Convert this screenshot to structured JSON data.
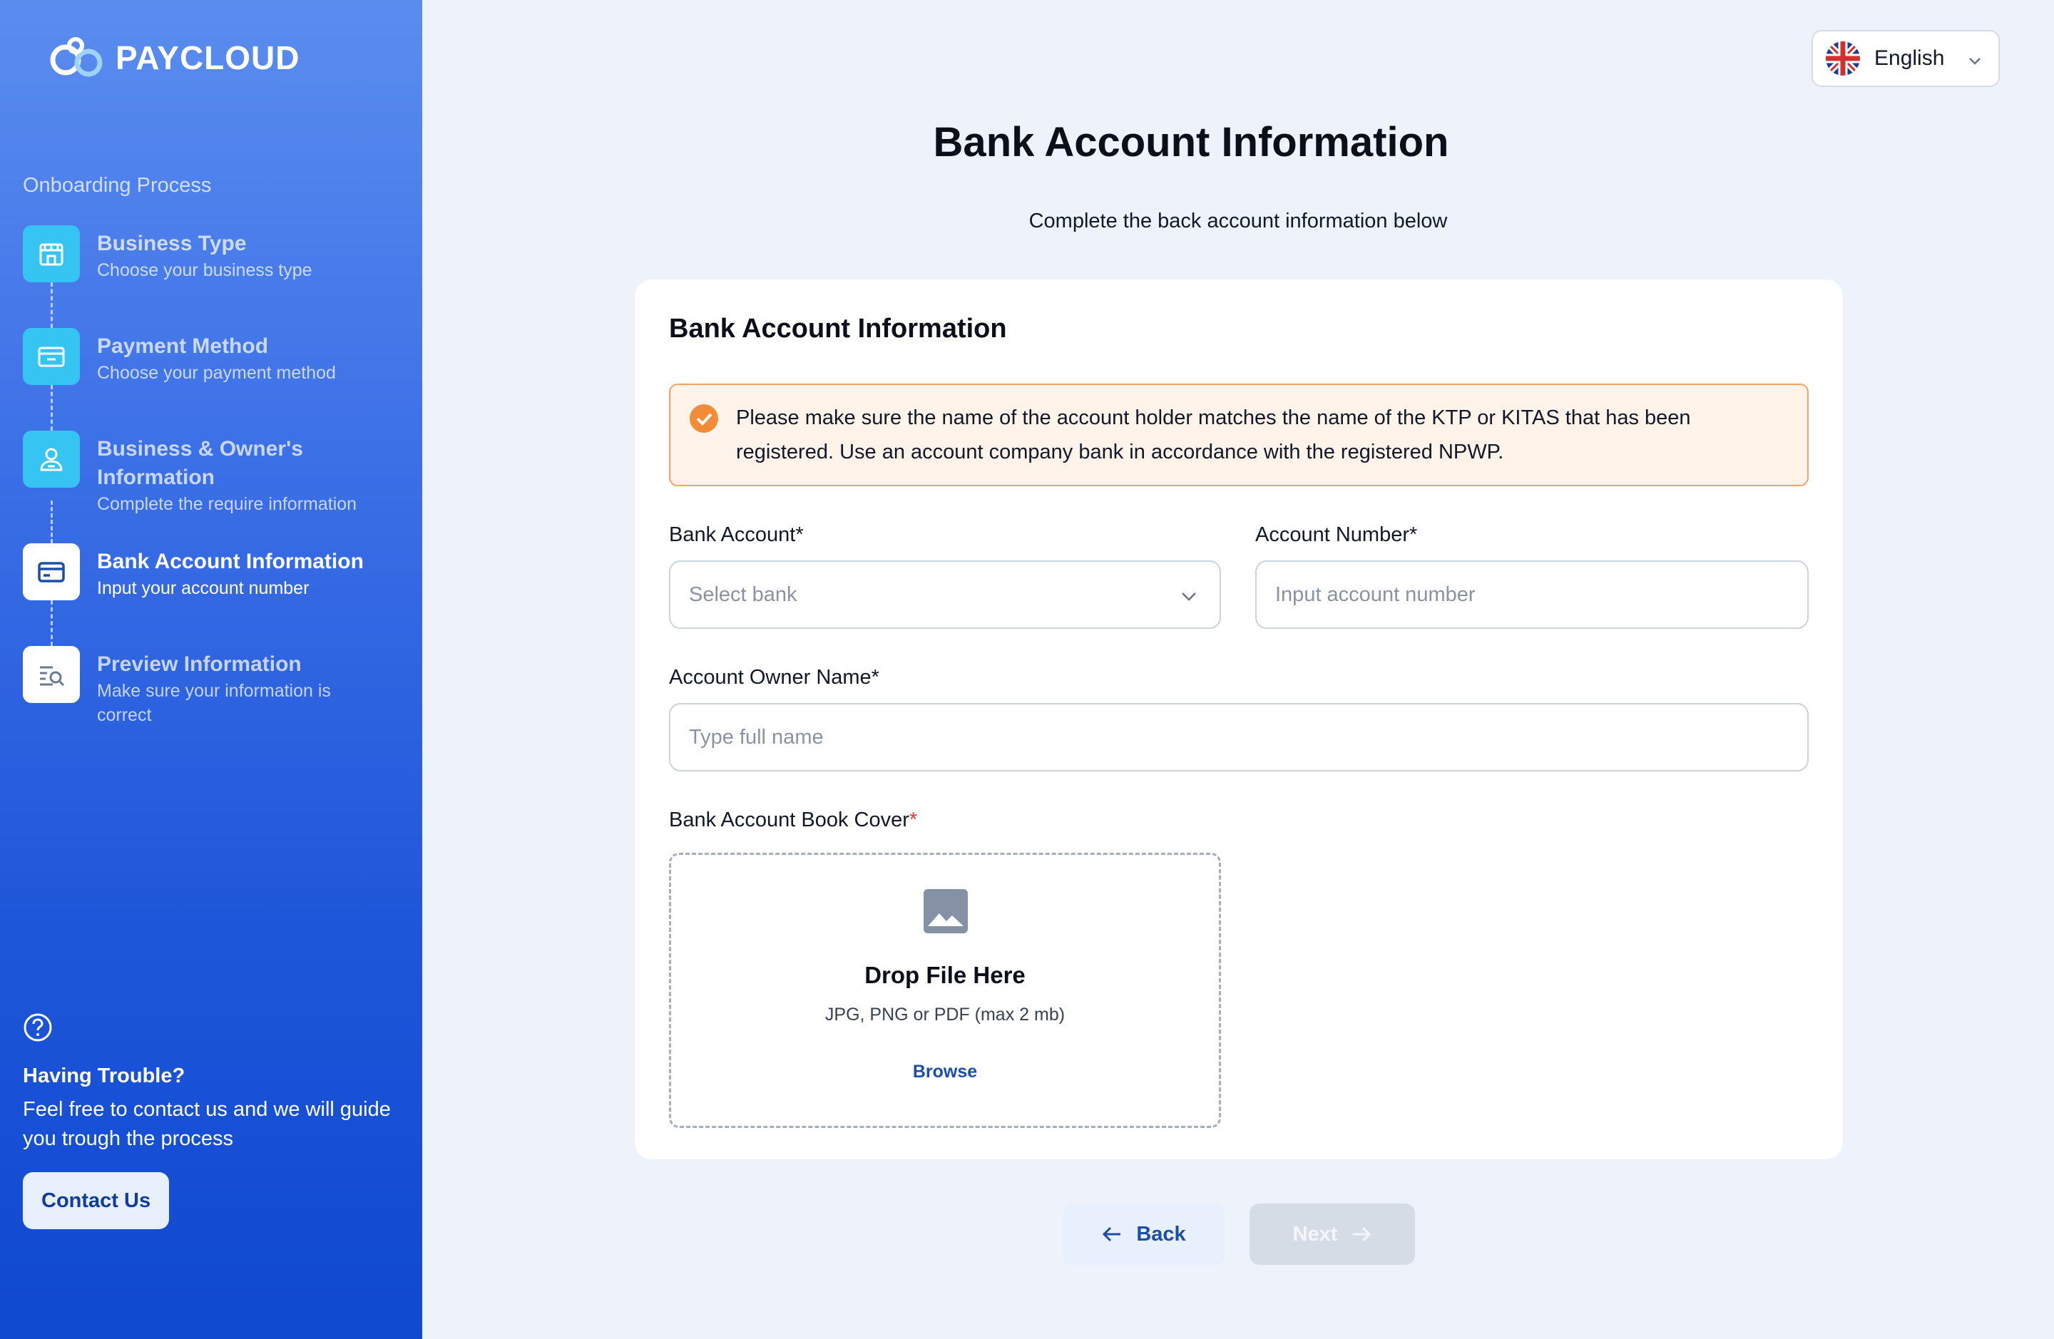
{
  "brand": {
    "name": "PAYCLOUD"
  },
  "sidebar": {
    "section_label": "Onboarding Process",
    "steps": [
      {
        "title": "Business Type",
        "description": "Choose your business type",
        "icon": "store-icon",
        "active": false
      },
      {
        "title": "Payment Method",
        "description": "Choose your payment method",
        "icon": "wallet-icon",
        "active": false
      },
      {
        "title": "Business & Owner's Information",
        "description": "Complete the require information",
        "icon": "user-id-icon",
        "active": false
      },
      {
        "title": "Bank Account Information",
        "description": "Input your account number",
        "icon": "card-icon",
        "active": true
      },
      {
        "title": "Preview Information",
        "description": "Make sure your information is correct",
        "icon": "search-list-icon",
        "active": false
      }
    ],
    "help": {
      "icon": "question-circle-icon",
      "title": "Having Trouble?",
      "text": "Feel free to contact us and we will guide you trough the process",
      "contact_label": "Contact Us"
    }
  },
  "language": {
    "selected": "English",
    "flag": "uk-flag-icon"
  },
  "header": {
    "title": "Bank Account Information",
    "subtitle": "Complete the back account information below"
  },
  "form": {
    "card_title": "Bank Account Information",
    "alert": "Please make sure the name of the account holder matches the name of the KTP or KITAS that has been registered. Use an account company bank in accordance with the registered NPWP.",
    "bank_account": {
      "label": "Bank Account*",
      "placeholder": "Select bank"
    },
    "account_number": {
      "label": "Account Number*",
      "placeholder": "Input account number"
    },
    "owner_name": {
      "label": "Account Owner Name*",
      "placeholder": "Type full name"
    },
    "book_cover": {
      "label": "Bank Account Book Cover",
      "required_mark": "*",
      "drop_title": "Drop File Here",
      "drop_hint": "JPG, PNG or PDF (max 2 mb)",
      "browse_label": "Browse"
    }
  },
  "actions": {
    "back_label": "Back",
    "next_label": "Next",
    "next_enabled": false
  },
  "colors": {
    "accent": "#1B4EA8",
    "step_icon": "#36C4F3",
    "alert_border": "#F5A15F",
    "alert_bg": "#FFF3EA",
    "page_bg": "#EEF2FA"
  }
}
